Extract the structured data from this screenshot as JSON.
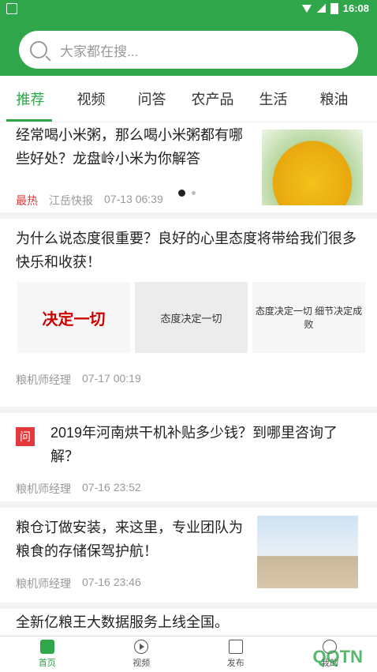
{
  "status": {
    "time": "16:08"
  },
  "search": {
    "placeholder": "大家都在搜..."
  },
  "tabs": [
    "推荐",
    "视频",
    "问答",
    "农产品",
    "生活",
    "粮油"
  ],
  "articles": [
    {
      "title": "经常喝小米粥，那么喝小米粥都有哪些好处？龙盘岭小米为你解答",
      "tag": "最热",
      "source": "江岳快报",
      "time": "07-13 06:39"
    },
    {
      "title": "为什么说态度很重要？良好的心里态度将带给我们很多快乐和收获！",
      "source": "粮机师经理",
      "time": "07-17 00:19",
      "img_texts": [
        "决定一切",
        "态度决定一切",
        "态度决定一切 细节决定成败"
      ]
    },
    {
      "badge": "问",
      "title": "2019年河南烘干机补贴多少钱？到哪里咨询了解？",
      "source": "粮机师经理",
      "time": "07-16 23:52"
    },
    {
      "title": "粮仓订做安装，来这里，专业团队为粮食的存储保驾护航！",
      "source": "粮机师经理",
      "time": "07-16 23:46"
    },
    {
      "title": "全新亿粮王大数据服务上线全国。"
    }
  ],
  "nav": [
    "首页",
    "视频",
    "发布",
    "我的"
  ],
  "watermark": "QQTN"
}
